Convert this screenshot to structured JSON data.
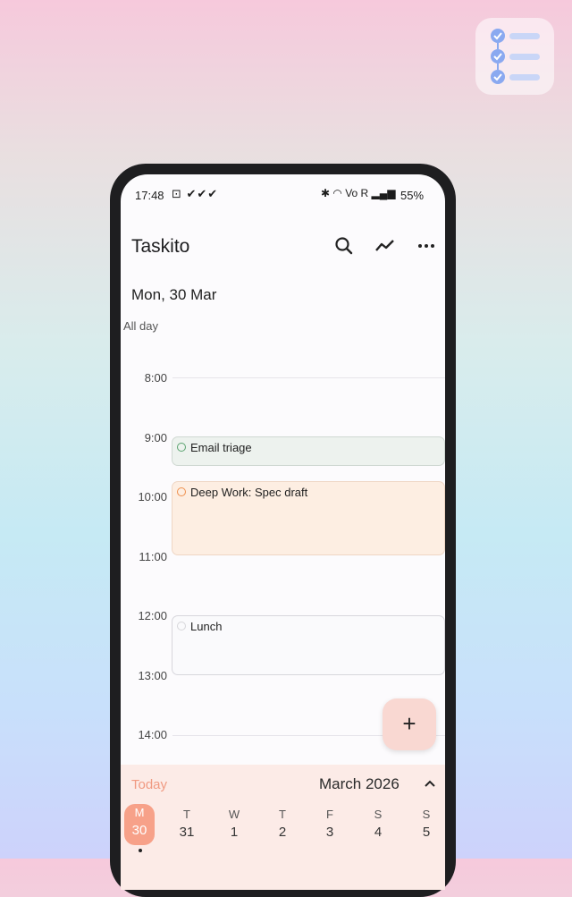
{
  "status_bar": {
    "time": "17:48",
    "left_icons": "⊡ ✔✔✔",
    "right_icons": "✱ ◠ Vo R ▂▄▆",
    "battery": "55%"
  },
  "app": {
    "title": "Taskito",
    "date_heading": "Mon, 30 Mar",
    "all_day_label": "All day"
  },
  "timeline": {
    "hours": [
      "8:00",
      "9:00",
      "10:00",
      "11:00",
      "12:00",
      "13:00",
      "14:00"
    ]
  },
  "events": [
    {
      "title": "Email triage",
      "color": "#5aa36f"
    },
    {
      "title": "Deep Work: Spec draft",
      "color": "#ef8f4c"
    },
    {
      "title": "Lunch",
      "color": "#d6d6da"
    }
  ],
  "fab": {
    "icon": "plus-icon",
    "glyph": "+"
  },
  "calendar_strip": {
    "today_label": "Today",
    "month": "March 2026",
    "days": [
      {
        "name": "M",
        "date": "30",
        "selected": true
      },
      {
        "name": "T",
        "date": "31"
      },
      {
        "name": "W",
        "date": "1"
      },
      {
        "name": "T",
        "date": "2"
      },
      {
        "name": "F",
        "date": "3"
      },
      {
        "name": "S",
        "date": "4"
      },
      {
        "name": "S",
        "date": "5"
      }
    ]
  },
  "colors": {
    "accent": "#f7a189",
    "fab": "#f9d8d2",
    "bottom_sheet": "#fcebe7",
    "badge_icon": "#8aa9f0"
  }
}
